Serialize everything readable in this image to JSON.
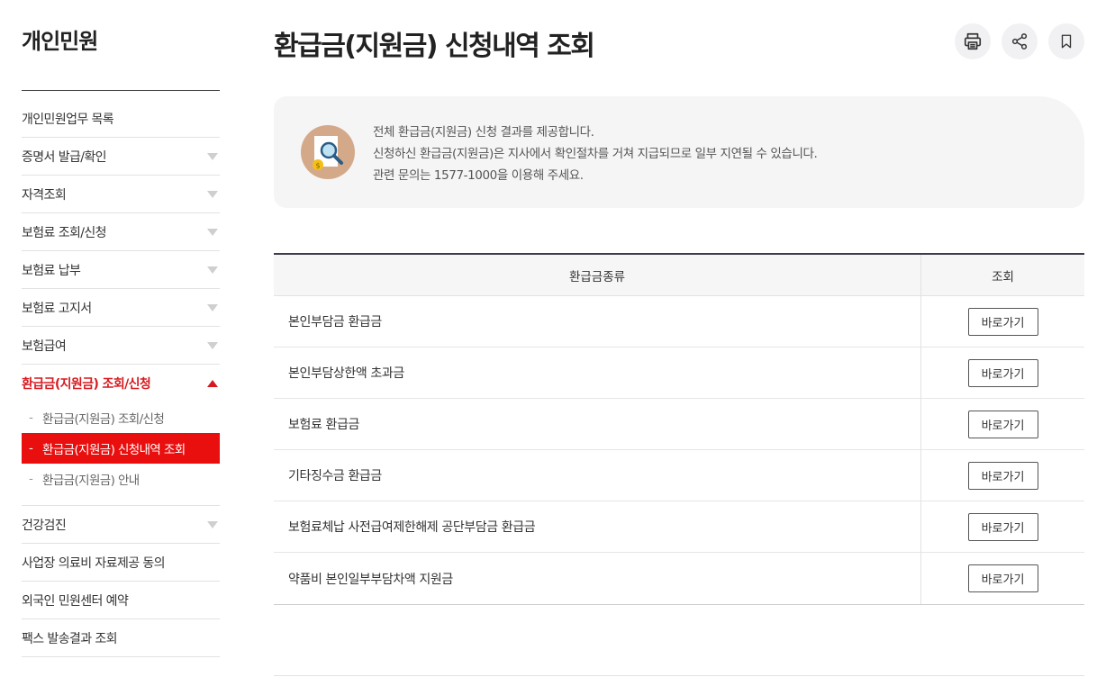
{
  "sidebar": {
    "title": "개인민원",
    "items": [
      {
        "label": "개인민원업무 목록"
      },
      {
        "label": "증명서 발급/확인"
      },
      {
        "label": "자격조회"
      },
      {
        "label": "보험료 조회/신청"
      },
      {
        "label": "보험료 납부"
      },
      {
        "label": "보험료 고지서"
      },
      {
        "label": "보험급여"
      },
      {
        "label": "환급금(지원금) 조회/신청"
      },
      {
        "label": "건강검진"
      },
      {
        "label": "사업장 의료비 자료제공 동의"
      },
      {
        "label": "외국인 민원센터 예약"
      },
      {
        "label": "팩스 발송결과 조회"
      }
    ],
    "subitems": [
      {
        "label": "환급금(지원금) 조회/신청"
      },
      {
        "label": "환급금(지원금) 신청내역 조회"
      },
      {
        "label": "환급금(지원금) 안내"
      }
    ],
    "dash": "-"
  },
  "page": {
    "title": "환급금(지원금) 신청내역 조회"
  },
  "info": {
    "lines": [
      "전체 환급금(지원금) 신청 결과를 제공합니다.",
      "신청하신 환급금(지원금)은 지사에서 확인절차를 거쳐 지급되므로 일부 지연될 수 있습니다.",
      "관련 문의는 1577-1000을 이용해 주세요."
    ]
  },
  "table": {
    "headers": [
      "환급금종류",
      "조회"
    ],
    "rows": [
      {
        "name": "본인부담금 환급금",
        "button": "바로가기"
      },
      {
        "name": "본인부담상한액 초과금",
        "button": "바로가기"
      },
      {
        "name": "보험료 환급금",
        "button": "바로가기"
      },
      {
        "name": "기타징수금 환급금",
        "button": "바로가기"
      },
      {
        "name": "보험료체납 사전급여제한해제 공단부담금 환급금",
        "button": "바로가기"
      },
      {
        "name": "약품비 본인일부부담차액 지원금",
        "button": "바로가기"
      }
    ]
  },
  "icons": {
    "print": "printer-icon",
    "share": "share-icon",
    "bookmark": "bookmark-icon",
    "info": "document-search-coin-icon"
  },
  "colors": {
    "accent_red": "#d7191f",
    "active_bg": "#e90f0f",
    "table_border": "#3d3d4a"
  }
}
